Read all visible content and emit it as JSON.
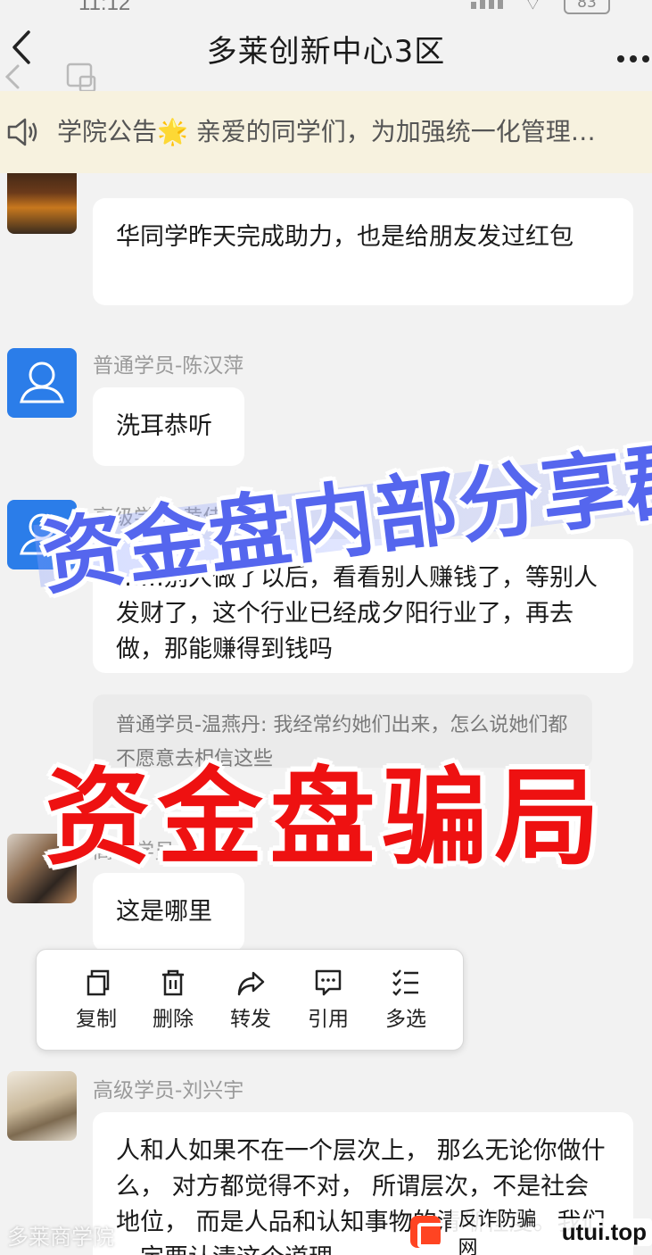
{
  "status_bar": {
    "time": "11:12",
    "battery": "83"
  },
  "header": {
    "title": "多莱创新中心3区"
  },
  "notice": {
    "text": "学院公告🌟 亲爱的同学们，为加强统一化管理…"
  },
  "messages": [
    {
      "text": "华同学昨天完成助力，也是给朋友发过红包"
    },
    {
      "sender": "普通学员-陈汉萍",
      "text": "洗耳恭听"
    },
    {
      "sender": "高级学员-黄佳",
      "text": "……别人做了以后，看看别人赚钱了，等别人发财了，这个行业已经成夕阳行业了，再去做，那能赚得到钱吗"
    },
    {
      "quote": "普通学员-温燕丹: 我经常约她们出来，怎么说她们都不愿意去相信这些"
    },
    {
      "sender": "高级学员-李瑞",
      "text": "这是哪里"
    },
    {
      "sender": "高级学员-刘兴宇",
      "text": "人和人如果不在一个层次上， 那么无论你做什么， 对方都觉得不对， 所谓层次，不是社会地位， 而是人品和认知事物的清晰程度。我们一定要认清这个道理"
    }
  ],
  "context_menu": {
    "items": [
      {
        "label": "复制",
        "icon": "copy-icon"
      },
      {
        "label": "删除",
        "icon": "trash-icon"
      },
      {
        "label": "转发",
        "icon": "forward-icon"
      },
      {
        "label": "引用",
        "icon": "quote-icon"
      },
      {
        "label": "多选",
        "icon": "multiselect-icon"
      }
    ]
  },
  "overlay": {
    "banner": "资金盘内部分享群",
    "headline": "资金盘骗局"
  },
  "footer": {
    "caption": "多莱商学院",
    "watermark_text": "反诈防骗网",
    "watermark_domain": "utui.top"
  },
  "colors": {
    "avatar_blue": "#2b7de9",
    "headline_red": "#ee1111",
    "banner_blue": "#5566ee",
    "notice_bg": "#f7f2df"
  }
}
